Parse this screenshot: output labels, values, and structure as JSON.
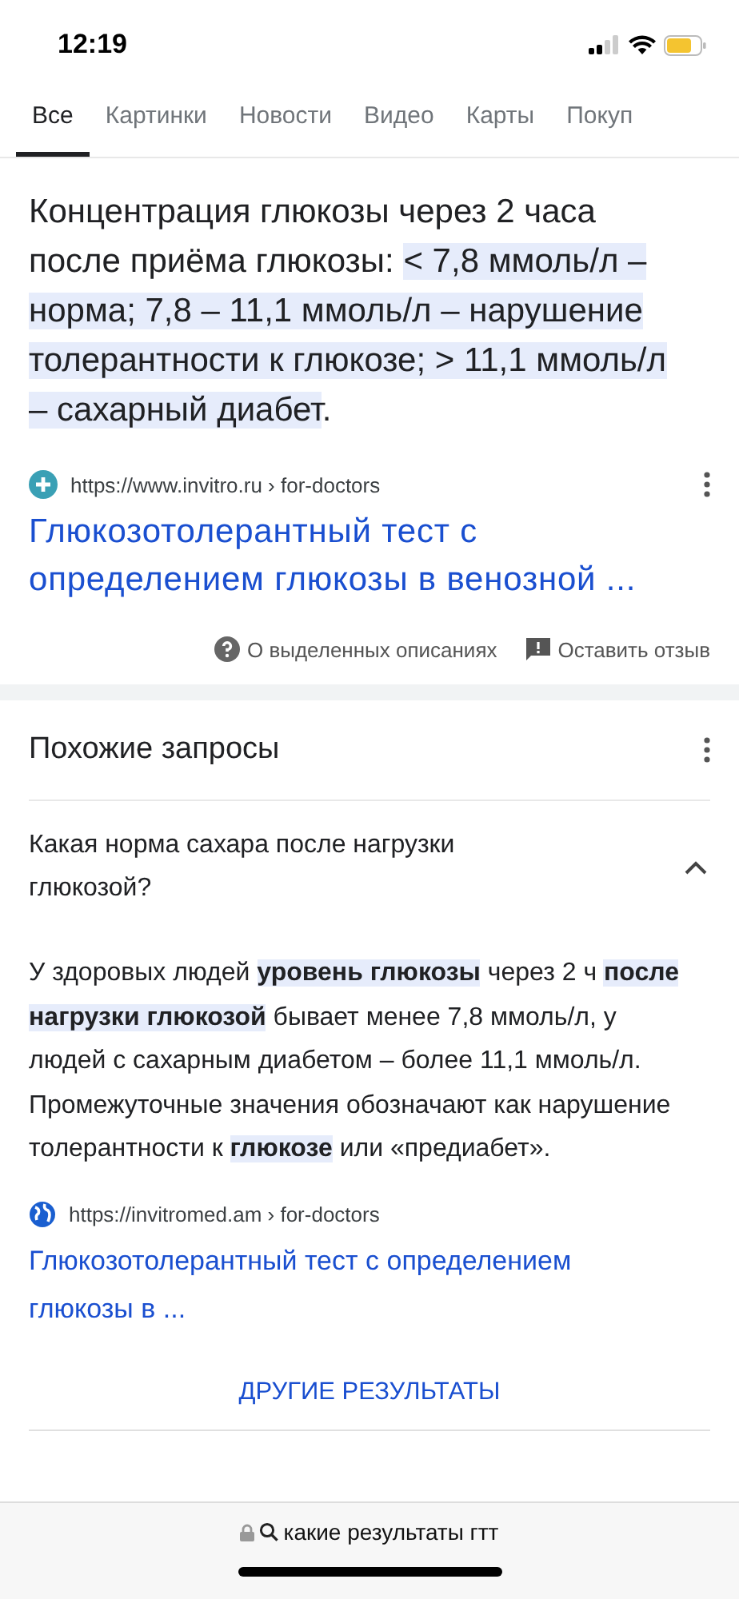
{
  "status_bar": {
    "time": "12:19"
  },
  "tabs": [
    {
      "label": "Все",
      "selected": true
    },
    {
      "label": "Картинки",
      "selected": false
    },
    {
      "label": "Новости",
      "selected": false
    },
    {
      "label": "Видео",
      "selected": false
    },
    {
      "label": "Карты",
      "selected": false
    },
    {
      "label": "Покуп",
      "selected": false
    }
  ],
  "featured_snippet": {
    "text": [
      {
        "text": "Концентрация глюкозы через 2 часа после приёма глюкозы: ",
        "highlighted": false
      },
      {
        "text": "< 7,8 ммоль/л – норма; 7,8 – 11,1 ммоль/л – нарушение толерантности к глюкозе; > 11,1 ммоль/л – сахарный диабет",
        "highlighted": true
      },
      {
        "text": ".",
        "highlighted": false
      }
    ],
    "url": "https://www.invitro.ru › for-doctors",
    "title": "Глюкозотолерантный тест с определением глюкозы в венозной ...",
    "footer": [
      "О выделенных описаниях",
      "Оставить отзыв"
    ]
  },
  "related": {
    "heading": "Похожие запросы",
    "question": {
      "text": "Какая норма сахара после нагрузки глюкозой?",
      "expanded": true
    },
    "answer": [
      {
        "text": "У здоровых людей ",
        "highlighted": false
      },
      {
        "text": "уровень глюкозы",
        "highlighted": true
      },
      {
        "text": " через 2 ч ",
        "highlighted": false
      },
      {
        "text": "после нагрузки глюкозой",
        "highlighted": true
      },
      {
        "text": " бывает менее 7,8 ммоль/л, у людей с сахарным диабетом – более 11,1 ммоль/л. Промежуточные значения обозначают как нарушение толерантности к ",
        "highlighted": false
      },
      {
        "text": "глюкозе",
        "highlighted": true
      },
      {
        "text": " или «предиабет».",
        "highlighted": false
      }
    ],
    "url": "https://invitromed.am › for-doctors",
    "title": "Глюкозотолерантный тест с определением глюкозы в ...",
    "more_button": "ДРУГИЕ РЕЗУЛЬТАТЫ"
  },
  "address_bar": {
    "query": "какие результаты гтт"
  }
}
